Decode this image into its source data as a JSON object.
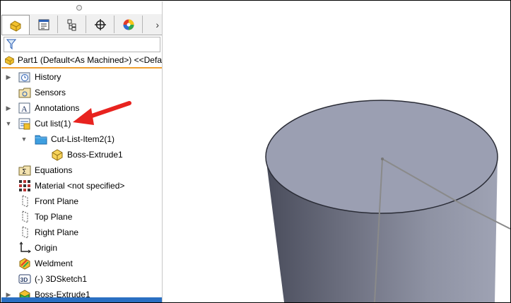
{
  "feature_manager": {
    "tab_icons": [
      "feature-manager-icon",
      "property-manager-icon",
      "configuration-manager-icon",
      "dimxpert-icon",
      "display-manager-icon"
    ],
    "more_tabs_glyph": "›",
    "filter_icon": "funnel-icon",
    "root_label": "Part1 (Default<As Machined>) <<Defa",
    "items": [
      {
        "label": "History",
        "icon": "history-icon"
      },
      {
        "label": "Sensors",
        "icon": "sensors-icon"
      },
      {
        "label": "Annotations",
        "icon": "annotations-icon"
      },
      {
        "label": "Cut list(1)",
        "icon": "cut-list-icon"
      },
      {
        "label": "Cut-List-Item2(1)",
        "icon": "folder-icon"
      },
      {
        "label": "Boss-Extrude1",
        "icon": "solid-body-icon"
      },
      {
        "label": "Equations",
        "icon": "equations-icon"
      },
      {
        "label": "Material <not specified>",
        "icon": "material-icon"
      },
      {
        "label": "Front Plane",
        "icon": "plane-icon"
      },
      {
        "label": "Top Plane",
        "icon": "plane-icon"
      },
      {
        "label": "Right Plane",
        "icon": "plane-icon"
      },
      {
        "label": "Origin",
        "icon": "origin-icon"
      },
      {
        "label": "Weldment",
        "icon": "weldment-icon"
      },
      {
        "label": "(-) 3DSketch1",
        "icon": "3d-sketch-icon"
      },
      {
        "label": "Boss-Extrude1",
        "icon": "boss-extrude-icon"
      }
    ]
  },
  "viewport": {
    "model": "cylinder",
    "colors": {
      "top_face": "#9b9fb2",
      "side_light": "#8a8ea0",
      "side_dark": "#4a4d5c",
      "sketch_line": "#8a8a8a"
    }
  },
  "callout": {
    "color": "#e8231f"
  }
}
